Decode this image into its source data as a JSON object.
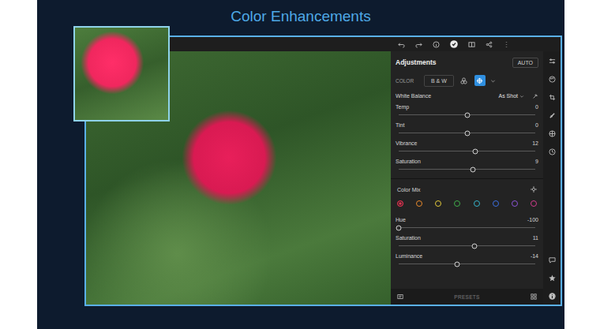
{
  "title": "Color Enhancements",
  "adjustments": {
    "title": "Adjustments",
    "auto_button": "AUTO"
  },
  "color_row": {
    "label": "COLOR",
    "bw_button": "B & W",
    "modes": [
      {
        "kind": "wheels",
        "selected": false
      },
      {
        "kind": "mix",
        "selected": true
      }
    ]
  },
  "white_balance": {
    "label": "White Balance",
    "value": "As Shot"
  },
  "sliders": [
    {
      "label": "Temp",
      "reading": "0",
      "level": 0.5
    },
    {
      "label": "Tint",
      "reading": "0",
      "level": 0.5
    },
    {
      "label": "Vibrance",
      "reading": "12",
      "level": 0.56
    },
    {
      "label": "Saturation",
      "reading": "9",
      "level": 0.545
    }
  ],
  "color_mix": {
    "title": "Color Mix",
    "swatches": [
      {
        "color": "#e0314f",
        "selected": true
      },
      {
        "color": "#e8892c",
        "selected": false
      },
      {
        "color": "#e3c93a",
        "selected": false
      },
      {
        "color": "#3fae4a",
        "selected": false
      },
      {
        "color": "#35b3c9",
        "selected": false
      },
      {
        "color": "#3c6fe0",
        "selected": false
      },
      {
        "color": "#8b54d6",
        "selected": false
      },
      {
        "color": "#d13b8c",
        "selected": false
      }
    ],
    "sliders": [
      {
        "label": "Hue",
        "reading": "-100",
        "level": 0
      },
      {
        "label": "Saturation",
        "reading": "11",
        "level": 0.555
      },
      {
        "label": "Luminance",
        "reading": "-14",
        "level": 0.43
      }
    ]
  },
  "bottom_bar": {
    "label": "PRESETS"
  }
}
